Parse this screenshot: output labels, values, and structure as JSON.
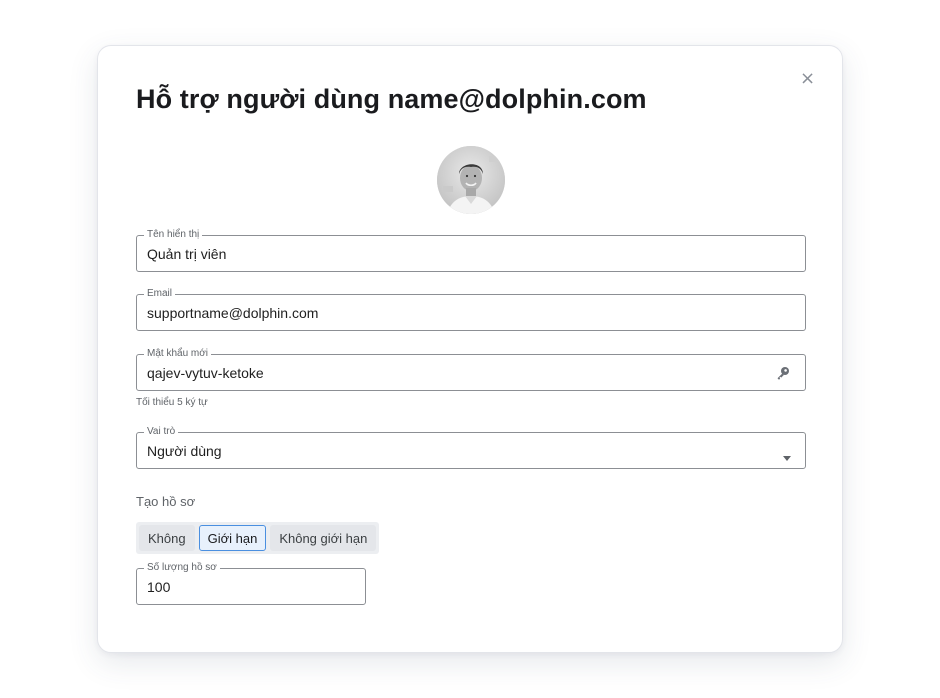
{
  "dialog": {
    "title": "Hỗ trợ người dùng name@dolphin.com",
    "close_icon": "close-icon",
    "close_glyph": "×"
  },
  "fields": {
    "display_name": {
      "label": "Tên hiển thị",
      "value": "Quản trị viên"
    },
    "email": {
      "label": "Email",
      "value": "supportname@dolphin.com"
    },
    "new_password": {
      "label": "Mật khẩu mới",
      "value": "qajev-vytuv-ketoke",
      "helper": "Tối thiểu 5 ký tự",
      "icon": "key-icon"
    },
    "role": {
      "label": "Vai trò",
      "value": "Người dùng",
      "icon": "dropdown-arrow-icon"
    },
    "profile_count": {
      "label": "Số lượng hồ sơ",
      "value": "100"
    }
  },
  "profile_creation": {
    "label": "Tạo hồ sơ",
    "options": [
      "Không",
      "Giới hạn",
      "Không giới hạn"
    ],
    "selected": "Giới hạn"
  },
  "colors": {
    "accent": "#4a8fe0",
    "border": "#8c8f94"
  }
}
